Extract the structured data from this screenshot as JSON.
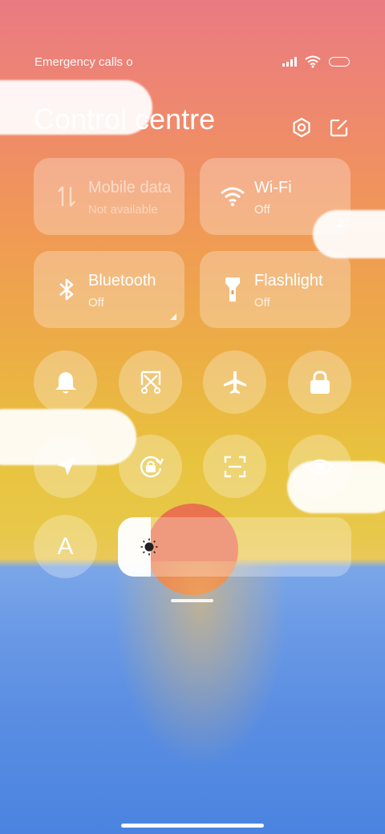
{
  "status_bar": {
    "carrier_text": "Emergency calls o",
    "icons": [
      "signal-icon",
      "wifi-icon",
      "battery-icon"
    ]
  },
  "header": {
    "title": "Control centre",
    "settings_icon": "gear-icon",
    "edit_icon": "edit-icon"
  },
  "tiles": [
    {
      "label": "Mobile data",
      "status": "Not available",
      "icon": "mobile-data-icon"
    },
    {
      "label": "Wi-Fi",
      "status": "Off",
      "icon": "wifi-icon"
    },
    {
      "label": "Bluetooth",
      "status": "Off",
      "icon": "bluetooth-icon"
    },
    {
      "label": "Flashlight",
      "status": "Off",
      "icon": "flashlight-icon"
    }
  ],
  "toggles": [
    {
      "icon": "bell-icon"
    },
    {
      "icon": "screenshot-icon"
    },
    {
      "icon": "airplane-icon"
    },
    {
      "icon": "lock-icon"
    },
    {
      "icon": "location-icon"
    },
    {
      "icon": "rotation-lock-icon"
    },
    {
      "icon": "scanner-icon"
    },
    {
      "icon": "reading-mode-icon"
    },
    {
      "icon": "font-icon",
      "glyph": "A"
    }
  ],
  "brightness": {
    "icon": "sun-icon",
    "level_fraction": 0.14
  },
  "colors": {
    "tile_bg": "rgba(255,255,255,0.28)",
    "text": "#ffffff"
  }
}
